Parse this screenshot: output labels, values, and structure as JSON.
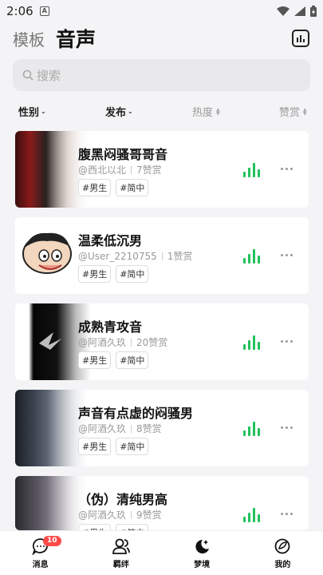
{
  "status_bar": {
    "time": "2:06",
    "app_icon_letter": "A"
  },
  "header": {
    "tabs": [
      {
        "label": "模板",
        "active": false
      },
      {
        "label": "音声",
        "active": true
      }
    ],
    "chart_icon": "bar-chart-icon"
  },
  "search": {
    "placeholder": "搜索"
  },
  "filters": [
    {
      "label": "性别",
      "style": "dropdown"
    },
    {
      "label": "发布",
      "style": "dropdown"
    },
    {
      "label": "热度",
      "style": "sort"
    },
    {
      "label": "赞赏",
      "style": "sort"
    }
  ],
  "voices": [
    {
      "title": "腹黑闷骚哥哥音",
      "author": "@西北以北",
      "likes": "7赞赏",
      "tags": [
        "#男生",
        "#简中"
      ]
    },
    {
      "title": "温柔低沉男",
      "author": "@User_2210755",
      "likes": "1赞赏",
      "tags": [
        "#男生",
        "#简中"
      ]
    },
    {
      "title": "成熟青攻音",
      "author": "@阿酒久玖",
      "likes": "20赞赏",
      "tags": [
        "#男生",
        "#简中"
      ]
    },
    {
      "title": "声音有点虚的闷骚男",
      "author": "@阿酒久玖",
      "likes": "8赞赏",
      "tags": [
        "#男生",
        "#简中"
      ]
    },
    {
      "title": "（伪）清纯男高",
      "author": "@阿酒久玖",
      "likes": "9赞赏",
      "tags": [
        "#男生",
        "#简中"
      ]
    }
  ],
  "bottom_nav": [
    {
      "label": "消息",
      "icon": "chat-bubble-icon",
      "badge": "10"
    },
    {
      "label": "羁绊",
      "icon": "users-icon"
    },
    {
      "label": "梦境",
      "icon": "moon-stars-icon"
    },
    {
      "label": "我的",
      "icon": "profile-leaf-icon"
    }
  ],
  "colors": {
    "accent_green": "#21c25b",
    "badge_red": "#ff4a4a"
  }
}
